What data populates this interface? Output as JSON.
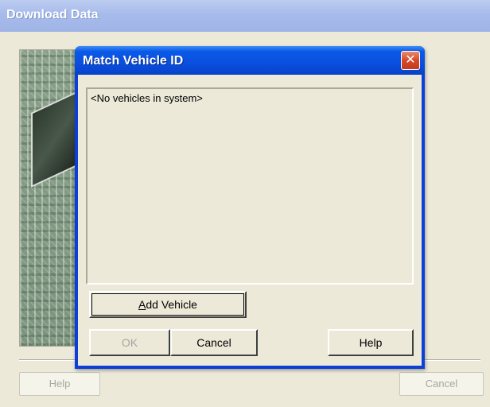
{
  "outer_window": {
    "title": "Download Data",
    "help_label": "Help",
    "cancel_label": "Cancel"
  },
  "dialog": {
    "title": "Match Vehicle ID",
    "close_glyph": "✕",
    "list_items": [
      "<No vehicles in system>"
    ],
    "add_vehicle_accesskey": "A",
    "add_vehicle_rest": "dd Vehicle",
    "ok_label": "OK",
    "cancel_label": "Cancel",
    "help_label": "Help"
  },
  "colors": {
    "dialog_title_blue": "#0a4fdd",
    "outer_title_inactive": "#a7bbeb",
    "close_red": "#d6492a",
    "face": "#ece9d8"
  }
}
